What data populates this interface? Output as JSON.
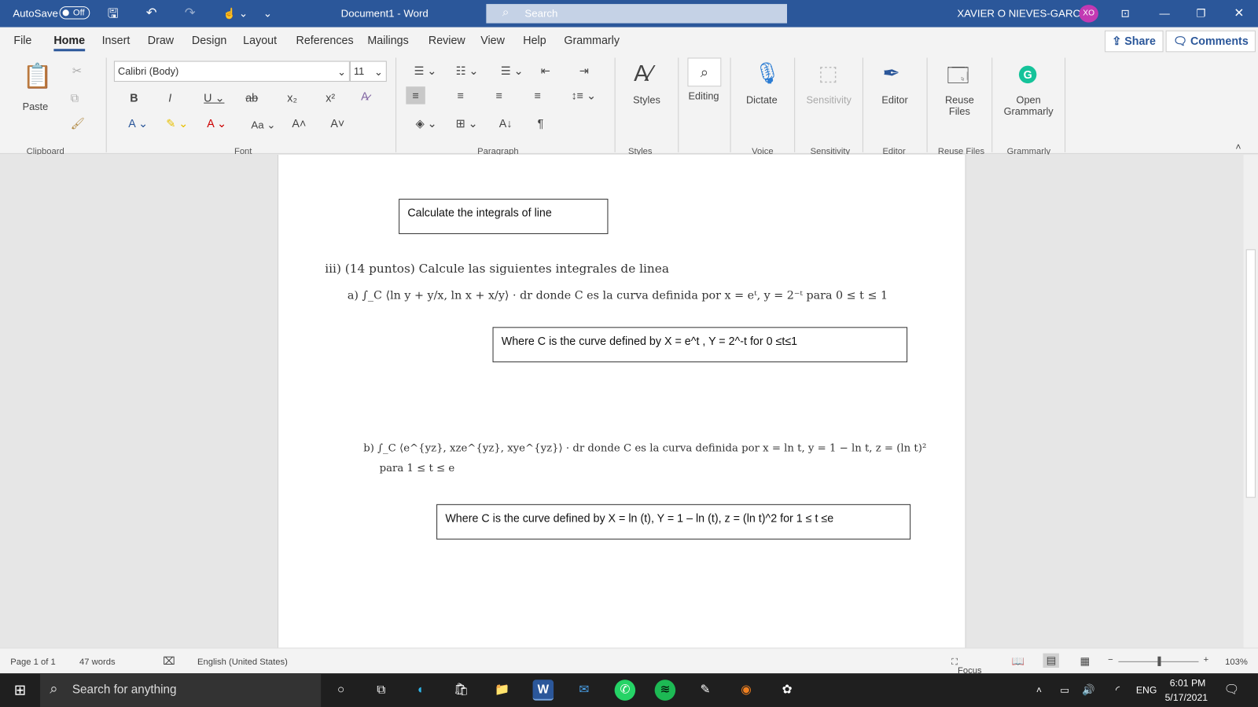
{
  "titlebar": {
    "autosave": "AutoSave",
    "autosave_state": "Off",
    "document": "Document1",
    "separator": "-",
    "app": "Word",
    "search_placeholder": "Search",
    "user": "XAVIER O NIEVES-GARCIA",
    "initials": "XO"
  },
  "menu": {
    "tabs": [
      "File",
      "Home",
      "Insert",
      "Draw",
      "Design",
      "Layout",
      "References",
      "Mailings",
      "Review",
      "View",
      "Help",
      "Grammarly"
    ],
    "share": "Share",
    "comments": "Comments"
  },
  "ribbon": {
    "paste": "Paste",
    "font_name": "Calibri (Body)",
    "font_size": "11",
    "styles": "Styles",
    "editing": "Editing",
    "dictate": "Dictate",
    "sensitivity": "Sensitivity",
    "editor": "Editor",
    "reuse_files": "Reuse Files",
    "open_grammarly": "Open Grammarly",
    "groups": [
      "Clipboard",
      "Font",
      "Paragraph",
      "Styles",
      "Voice",
      "Sensitivity",
      "Editor",
      "Reuse Files",
      "Grammarly"
    ]
  },
  "document": {
    "box1": "Calculate the integrals of line",
    "heading": "iii) (14 puntos) Calcule las siguientes integrales de linea",
    "part_a": "a) ∫_C ⟨ln y + y/x, ln x + x/y⟩ · dr donde C es la curva definida por x = eᵗ, y = 2⁻ᵗ para 0 ≤ t ≤ 1",
    "box2": "Where C is the curve defined by X = e^t , Y = 2^-t  for 0 ≤t≤1",
    "part_b": "b) ∫_C ⟨e^{yz}, xze^{yz}, xye^{yz}⟩ · dr donde C es la curva definida por x = ln t, y = 1 − ln t, z = (ln t)²",
    "part_b2": "para 1 ≤ t ≤ e",
    "box3": "Where C is the curve defined by X = ln (t), Y = 1 – ln (t), z = (ln t)^2  for 1 ≤ t ≤e"
  },
  "status": {
    "page": "Page 1 of 1",
    "words": "47 words",
    "language": "English (United States)",
    "focus": "Focus",
    "zoom": "103%",
    "zoom_value": 103
  },
  "taskbar": {
    "search_placeholder": "Search for anything",
    "lang": "ENG",
    "time": "6:01 PM",
    "date": "5/17/2021"
  },
  "colors": {
    "word_blue": "#2b579a",
    "avatar": "#c239b3",
    "grammarly": "#15c39a"
  }
}
